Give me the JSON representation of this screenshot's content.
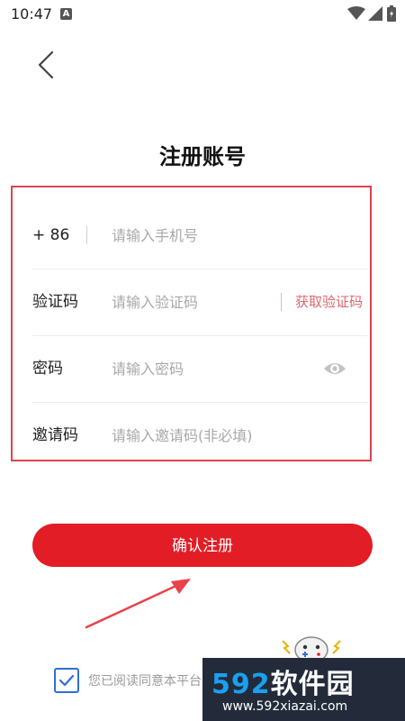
{
  "status_bar": {
    "time": "10:47",
    "notification_icon": "A"
  },
  "page": {
    "title": "注册账号"
  },
  "form": {
    "phone": {
      "prefix": "+ 86",
      "placeholder": "请输入手机号"
    },
    "code": {
      "label": "验证码",
      "placeholder": "请输入验证码",
      "get_code_label": "获取验证码"
    },
    "password": {
      "label": "密码",
      "placeholder": "请输入密码"
    },
    "invite": {
      "label": "邀请码",
      "placeholder": "请输入邀请码(非必填)"
    }
  },
  "submit": {
    "label": "确认注册"
  },
  "agreement": {
    "text": "您已阅读同意本平台",
    "checked": true
  },
  "watermark": {
    "digits": "592",
    "cn_text": "软件园",
    "url": "www.592xiazai.com"
  },
  "colors": {
    "accent": "#e21d26",
    "outline": "#e0434b",
    "link": "#e0666d",
    "checkbox": "#2f6fd6"
  },
  "icons": [
    "back-arrow-icon",
    "eye-icon",
    "wifi-icon",
    "signal-icon",
    "battery-icon",
    "check-icon"
  ]
}
